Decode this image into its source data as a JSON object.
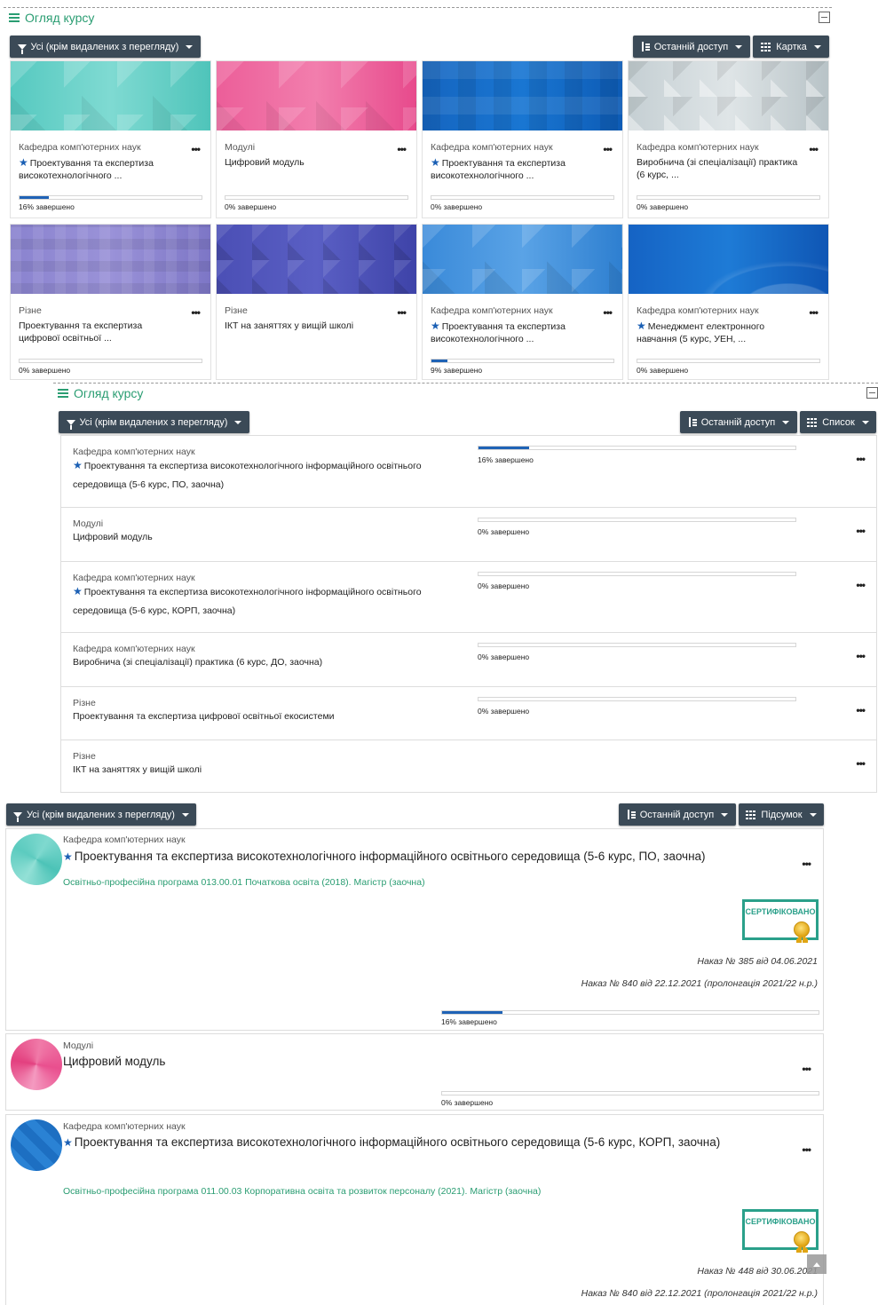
{
  "card_view": {
    "title": "Огляд курсу",
    "filter_label": "Усі (крім видалених з перегляду)",
    "sort_label": "Останній доступ",
    "view_label": "Картка",
    "courses": [
      {
        "category": "Кафедра комп'ютерних наук",
        "starred": true,
        "name": "Проектування та експертиза високотехнологічного ...",
        "progress": 16,
        "progress_text": "16% завершено",
        "pattern": "teal"
      },
      {
        "category": "Модулі",
        "starred": false,
        "name": "Цифровий модуль",
        "progress": 0,
        "progress_text": "0% завершено",
        "pattern": "pink"
      },
      {
        "category": "Кафедра комп'ютерних наук",
        "starred": true,
        "name": "Проектування та експертиза високотехнологічного ...",
        "progress": 0,
        "progress_text": "0% завершено",
        "pattern": "blue-squares"
      },
      {
        "category": "Кафедра комп'ютерних наук",
        "starred": false,
        "name": "Виробнича (зі спеціалізації) практика (6 курс, ...",
        "progress": 0,
        "progress_text": "0% завершено",
        "pattern": "grey"
      },
      {
        "category": "Різне",
        "starred": false,
        "name": "Проектування та експертиза цифрової освітньої ...",
        "progress": 0,
        "progress_text": "0% завершено",
        "pattern": "violet-squares"
      },
      {
        "category": "Різне",
        "starred": false,
        "name": "ІКТ на заняттях у вищій школі",
        "progress": null,
        "progress_text": "",
        "pattern": "indigo"
      },
      {
        "category": "Кафедра комп'ютерних наук",
        "starred": true,
        "name": "Проектування та експертиза високотехнологічного ...",
        "progress": 9,
        "progress_text": "9% завершено",
        "pattern": "sky"
      },
      {
        "category": "Кафедра комп'ютерних наук",
        "starred": true,
        "name": "Менеджмент електронного навчання (5 курс, УЕН, ...",
        "progress": 0,
        "progress_text": "0% завершено",
        "pattern": "wave"
      }
    ]
  },
  "list_view": {
    "title": "Огляд курсу",
    "filter_label": "Усі (крім видалених з перегляду)",
    "sort_label": "Останній доступ",
    "view_label": "Список",
    "courses": [
      {
        "category": "Кафедра комп'ютерних наук",
        "starred": true,
        "name": "Проектування та експертиза високотехнологічного інформаційного освітнього",
        "name2": "середовища (5-6 курс, ПО, заочна)",
        "progress": 16,
        "progress_text": "16% завершено"
      },
      {
        "category": "Модулі",
        "starred": false,
        "name": "Цифровий модуль",
        "name2": "",
        "progress": 0,
        "progress_text": "0% завершено"
      },
      {
        "category": "Кафедра комп'ютерних наук",
        "starred": true,
        "name": "Проектування та експертиза високотехнологічного інформаційного освітнього",
        "name2": "середовища (5-6 курс, КОРП, заочна)",
        "progress": 0,
        "progress_text": "0% завершено"
      },
      {
        "category": "Кафедра комп'ютерних наук",
        "starred": false,
        "name": "Виробнича (зі спеціалізації) практика (6 курс, ДО, заочна)",
        "name2": "",
        "progress": 0,
        "progress_text": "0% завершено"
      },
      {
        "category": "Різне",
        "starred": false,
        "name": "Проектування та експертиза цифрової освітньої екосистеми",
        "name2": "",
        "progress": 0,
        "progress_text": "0% завершено"
      },
      {
        "category": "Різне",
        "starred": false,
        "name": "ІКТ на заняттях у вищій школі",
        "name2": "",
        "progress": null,
        "progress_text": ""
      }
    ]
  },
  "summary_view": {
    "filter_label": "Усі (крім видалених з перегляду)",
    "sort_label": "Останній доступ",
    "view_label": "Підсумок",
    "certified_label": "СЕРТИФІКОВАНО",
    "courses": [
      {
        "category": "Кафедра комп'ютерних наук",
        "starred": true,
        "name": "Проектування та експертиза високотехнологічного інформаційного освітнього середовища (5-6 курс, ПО, заочна)",
        "program": "Освітньо-професійна програма 013.00.01 Початкова освіта (2018). Магістр (заочна)",
        "order1": "Наказ № 385 від 04.06.2021",
        "order2": "Наказ № 840 від 22.12.2021 (пролонгація 2021/22 н.р.)",
        "progress": 16,
        "progress_text": "16% завершено"
      },
      {
        "category": "Модулі",
        "starred": false,
        "name": "Цифровий модуль",
        "progress": 0,
        "progress_text": "0% завершено"
      },
      {
        "category": "Кафедра комп'ютерних наук",
        "starred": true,
        "name": "Проектування та експертиза високотехнологічного інформаційного освітнього середовища (5-6 курс, КОРП, заочна)",
        "program": "Освітньо-професійна програма 011.00.03 Корпоративна освіта та розвиток персоналу (2021). Магістр (заочна)",
        "order1": "Наказ № 448 від 30.06.2021",
        "order2": "Наказ № 840 від 22.12.2021 (пролонгація 2021/22 н.р.)"
      }
    ]
  },
  "colors": {
    "accent_green": "#2a9d72",
    "button_dark": "#3b4a57",
    "progress_blue": "#1f63b6",
    "star_blue": "#1a5fb4"
  }
}
